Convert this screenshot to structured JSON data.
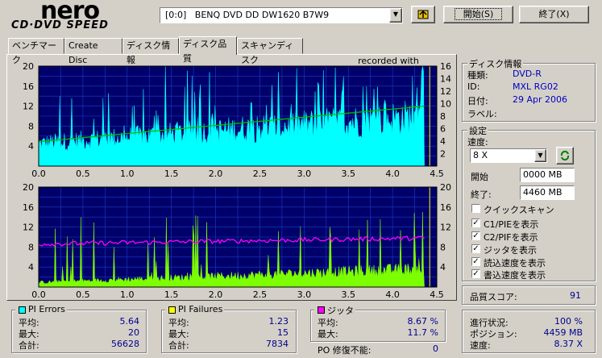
{
  "logo": {
    "brand": "nero",
    "product": "CD·DVD SPEED"
  },
  "drive_select": {
    "value": "[0:0]   BENQ DVD DD DW1620 B7W9"
  },
  "buttons": {
    "start": "開始(S)",
    "exit": "終了(X)"
  },
  "tabs": [
    {
      "label": "ベンチマーク"
    },
    {
      "label": "Create Disc"
    },
    {
      "label": "ディスク情報"
    },
    {
      "label": "ディスク品質"
    },
    {
      "label": "スキャンディスク"
    }
  ],
  "top_chart": {
    "annotation": "recorded with"
  },
  "disc_info": {
    "title": "ディスク情報",
    "type_label": "種類:",
    "type_value": "DVD-R",
    "id_label": "ID:",
    "id_value": "MXL RG02",
    "date_label": "日付:",
    "date_value": "29 Apr 2006",
    "label_label": "ラベル:"
  },
  "settings": {
    "title": "設定",
    "speed_label": "速度:",
    "speed_value": "8 X",
    "start_label": "開始",
    "start_value": "0000 MB",
    "end_label": "終了:",
    "end_value": "4460 MB",
    "checkboxes": [
      {
        "label": "クイックスキャン",
        "checked": false
      },
      {
        "label": "C1/PIEを表示",
        "checked": true
      },
      {
        "label": "C2/PIFを表示",
        "checked": true
      },
      {
        "label": "ジッタを表示",
        "checked": true
      },
      {
        "label": "読込速度を表示",
        "checked": true
      },
      {
        "label": "書込速度を表示",
        "checked": true
      }
    ]
  },
  "quality": {
    "label": "品質スコア:",
    "value": "91"
  },
  "progress": {
    "status_label": "進行状況:",
    "status_value": "100 %",
    "position_label": "ポジション:",
    "position_value": "4459 MB",
    "speed_label": "速度:",
    "speed_value": "8.37 X"
  },
  "pi_errors": {
    "title": "PI Errors",
    "color": "#00ffff",
    "avg_label": "平均:",
    "avg": "5.64",
    "max_label": "最大:",
    "max": "20",
    "total_label": "合計:",
    "total": "56628"
  },
  "pi_failures": {
    "title": "PI Failures",
    "color": "#ffff00",
    "avg_label": "平均:",
    "avg": "1.23",
    "max_label": "最大:",
    "max": "15",
    "total_label": "合計:",
    "total": "7834"
  },
  "jitter": {
    "title": "ジッタ",
    "color": "#ff00ff",
    "avg_label": "平均:",
    "avg": "8.67 %",
    "max_label": "最大:",
    "max": "11.7 %"
  },
  "po": {
    "label": "PO 修復不能:",
    "value": "0"
  },
  "chart_data": [
    {
      "type": "area",
      "x_ticks": [
        "0.0",
        "0.5",
        "1.0",
        "1.5",
        "2.0",
        "2.5",
        "3.0",
        "3.5",
        "4.0",
        "4.5"
      ],
      "y_left_ticks": [
        "20",
        "16",
        "12",
        "8",
        "4"
      ],
      "y_right_ticks": [
        "16",
        "14",
        "12",
        "10",
        "8",
        "6",
        "4",
        "2"
      ],
      "xlim": [
        0,
        4.5
      ],
      "ylim_left": [
        0,
        20
      ],
      "ylim_right": [
        0,
        16
      ],
      "series": [
        {
          "name": "PI Errors",
          "color": "#00ffff",
          "x_end": 4.36,
          "typical_start": 5,
          "typical_end": 11,
          "max": 20
        },
        {
          "color": "#00c000",
          "x": [
            0,
            4.36
          ],
          "y": [
            3.9,
            9.6
          ]
        }
      ],
      "grid": true
    },
    {
      "type": "area",
      "x_ticks": [
        "0.0",
        "0.5",
        "1.0",
        "1.5",
        "2.0",
        "2.5",
        "3.0",
        "3.5",
        "4.0",
        "4.5"
      ],
      "y_left_ticks": [
        "20",
        "16",
        "12",
        "8",
        "4"
      ],
      "y_right_ticks": [
        "20",
        "16",
        "12",
        "8",
        "4"
      ],
      "xlim": [
        0,
        4.5
      ],
      "ylim_left": [
        0,
        20
      ],
      "ylim_right": [
        0,
        20
      ],
      "series": [
        {
          "name": "PI Failures",
          "color": "#7cff00",
          "x_end": 4.36,
          "typical_start": 1,
          "typical_end": 4,
          "max": 15
        },
        {
          "name": "ジッタ",
          "color": "#ff00ff",
          "x": [
            0,
            4.36
          ],
          "y": [
            8.6,
            9.8
          ]
        }
      ],
      "grid": true
    }
  ]
}
